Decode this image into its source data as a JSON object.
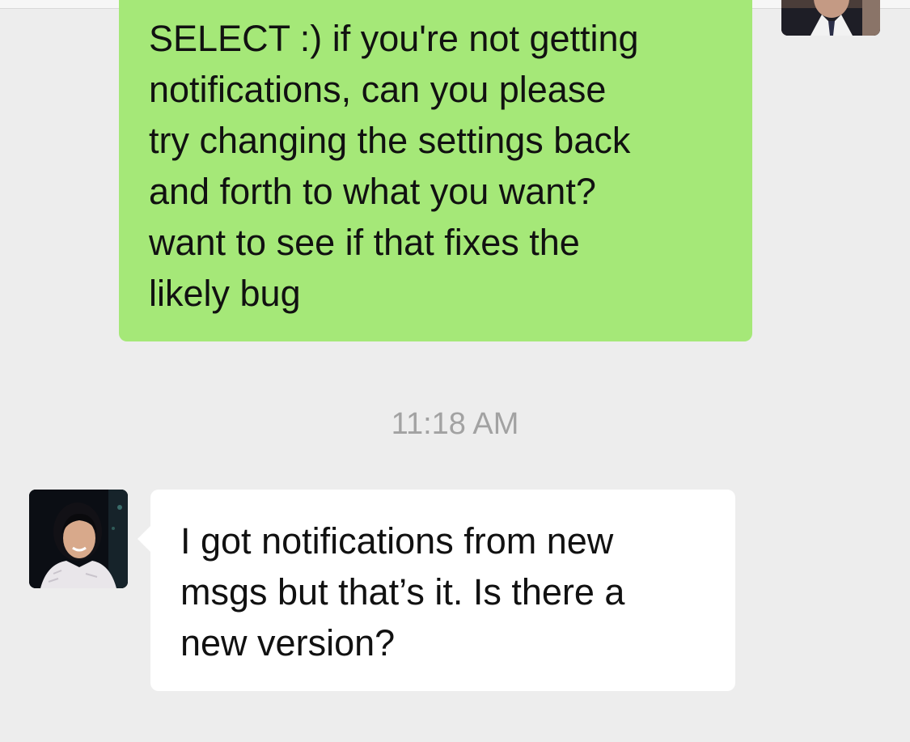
{
  "conversation": {
    "outgoing_message": {
      "text": "SELECT :) if you're not getting\nnotifications, can you please\ntry changing the settings back\nand forth to what you want?\nwant to see if that fixes the\nlikely bug"
    },
    "timestamp": "11:18 AM",
    "incoming_message": {
      "text": "I got notifications from new\nmsgs but that’s it. Is there a\nnew version?"
    }
  },
  "colors": {
    "background": "#ededed",
    "outgoing_bubble": "#a5e878",
    "incoming_bubble": "#ffffff",
    "timestamp_text": "#a2a2a2"
  }
}
